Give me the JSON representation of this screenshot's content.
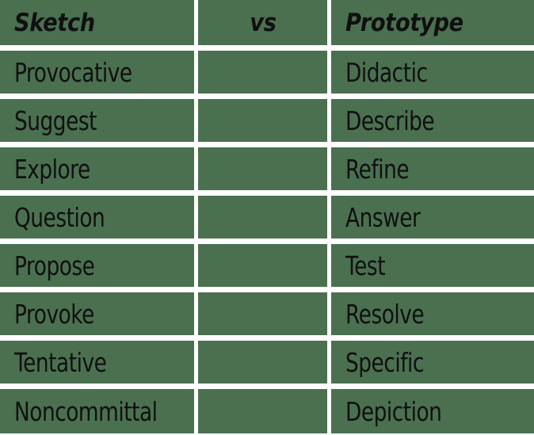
{
  "table": {
    "header": {
      "left": "Sketch",
      "middle": "vs",
      "right": "Prototype"
    },
    "rows": [
      {
        "left": "Provocative",
        "middle": "",
        "right": "Didactic"
      },
      {
        "left": "Suggest",
        "middle": "",
        "right": "Describe"
      },
      {
        "left": "Explore",
        "middle": "",
        "right": "Refine"
      },
      {
        "left": "Question",
        "middle": "",
        "right": "Answer"
      },
      {
        "left": "Propose",
        "middle": "",
        "right": "Test"
      },
      {
        "left": "Provoke",
        "middle": "",
        "right": "Resolve"
      },
      {
        "left": "Tentative",
        "middle": "",
        "right": "Specific"
      },
      {
        "left": "Noncommittal",
        "middle": "",
        "right": "Depiction"
      }
    ],
    "colors": {
      "cell_background": "#4a7050",
      "grid_line": "#ffffff",
      "text": "#101010"
    }
  }
}
